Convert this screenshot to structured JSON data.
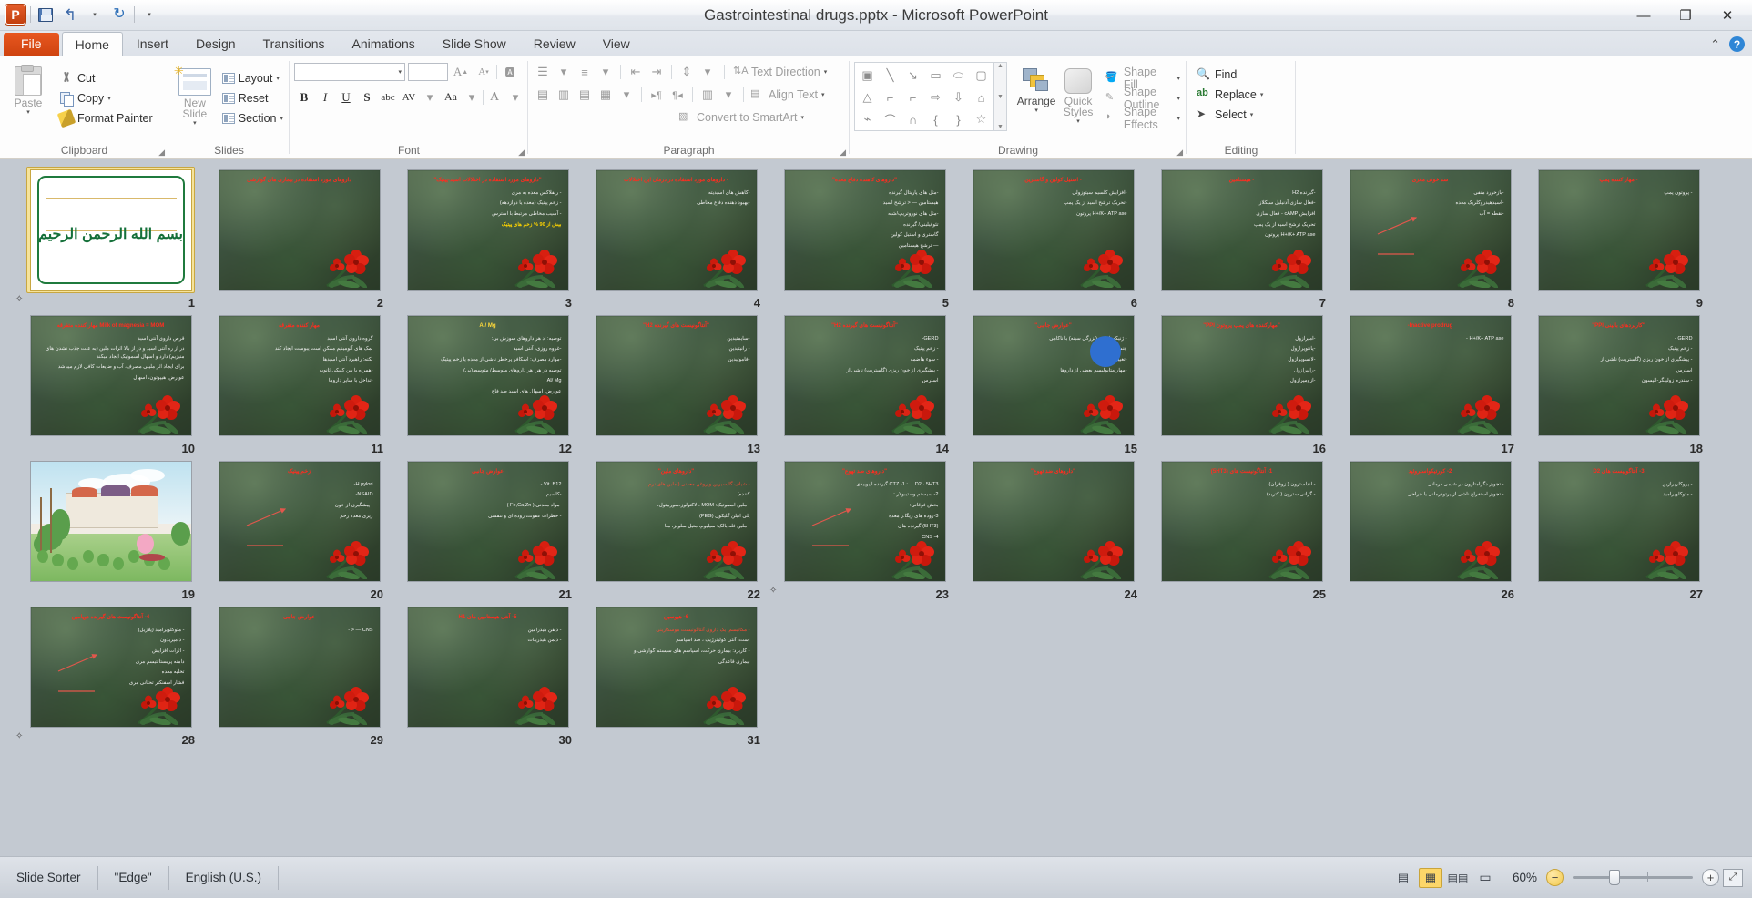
{
  "titlebar": {
    "doc_title": "Gastrointestinal drugs.pptx  -  Microsoft PowerPoint",
    "app_icon": "powerpoint-icon",
    "qat": [
      {
        "name": "save-icon",
        "label": "Save"
      },
      {
        "name": "undo-icon",
        "label": "↰"
      },
      {
        "name": "undo-dropdown-icon",
        "label": "▾"
      },
      {
        "name": "redo-icon",
        "label": "↻"
      },
      {
        "name": "customize-qat-icon",
        "label": "▾"
      }
    ],
    "window_controls": {
      "minimize": "—",
      "restore": "❐",
      "close": "✕"
    }
  },
  "ribbon": {
    "file_tab": "File",
    "tabs": [
      "Home",
      "Insert",
      "Design",
      "Transitions",
      "Animations",
      "Slide Show",
      "Review",
      "View"
    ],
    "active_tab": "Home",
    "minimize_ribbon_icon": "⌃",
    "help_icon": "?",
    "groups": {
      "clipboard": {
        "label": "Clipboard",
        "paste": "Paste",
        "cut": "Cut",
        "copy": "Copy",
        "format_painter": "Format Painter"
      },
      "slides": {
        "label": "Slides",
        "new_slide": "New Slide",
        "layout": "Layout",
        "reset": "Reset",
        "section": "Section"
      },
      "font": {
        "label": "Font",
        "font_name": "",
        "font_size": "",
        "grow_font": "A",
        "shrink_font": "A",
        "clear_formatting": "Aa",
        "bold": "B",
        "italic": "I",
        "underline": "U",
        "shadow": "S",
        "strikethrough": "abc",
        "character_spacing": "AV",
        "change_case": "Aa",
        "font_color": "A"
      },
      "paragraph": {
        "label": "Paragraph",
        "bullets": "Bullets",
        "numbering": "Numbering",
        "decrease_indent": "Decrease List Level",
        "increase_indent": "Increase List Level",
        "line_spacing": "Line Spacing",
        "align_left": "Align Left",
        "center": "Center",
        "align_right": "Align Right",
        "justify": "Justify",
        "ltr": "Left-to-Right",
        "rtl": "Right-to-Left",
        "columns": "Columns",
        "text_direction": "Text Direction",
        "align_text": "Align Text",
        "convert_to_smartart": "Convert to SmartArt"
      },
      "drawing": {
        "label": "Drawing",
        "arrange": "Arrange",
        "quick_styles": "Quick Styles",
        "shape_fill": "Shape Fill",
        "shape_outline": "Shape Outline",
        "shape_effects": "Shape Effects",
        "shapes": [
          "textbox",
          "line",
          "arrow",
          "rectangle",
          "oval",
          "rounded-rectangle",
          "triangle",
          "elbow-connector",
          "elbow-arrow-connector",
          "block-arrow-right",
          "block-arrow-down",
          "flowchart-shape",
          "freeform",
          "curve",
          "arc",
          "left-brace",
          "right-brace",
          "star"
        ]
      },
      "editing": {
        "label": "Editing",
        "find": "Find",
        "replace": "Replace",
        "select": "Select"
      }
    }
  },
  "statusbar": {
    "view_name": "Slide Sorter",
    "theme": "\"Edge\"",
    "language": "English (U.S.)",
    "view_buttons": [
      {
        "name": "normal-view-button",
        "label": "▤",
        "active": false
      },
      {
        "name": "slide-sorter-view-button",
        "label": "▦",
        "active": true
      },
      {
        "name": "reading-view-button",
        "label": "📖",
        "active": false
      },
      {
        "name": "slide-show-button",
        "label": "▭",
        "active": false
      }
    ],
    "zoom_level": "60%",
    "zoom_out_icon": "−",
    "zoom_in_icon": "+",
    "fit_to_window_icon": "fit-slide-icon"
  },
  "sorter": {
    "columns": 9,
    "selected_slide": 1,
    "slides": [
      {
        "n": 1,
        "type": "title-white",
        "bism": "بسم الله الرحمن الرحيم",
        "transition": true
      },
      {
        "n": 2,
        "type": "content",
        "title": "داروهای مورد استفاده در بیماری های گوارشی",
        "title_center": true,
        "lines": []
      },
      {
        "n": 3,
        "type": "content",
        "title": "\"داروهای مورد استفاده در اختلالات اسید-پپتیک\"",
        "lines": [
          "- ریفلاکس معده به مری",
          "- زخم پپتیک (معده یا دوازدهه)",
          "- آسیب مخاطی مرتبط با استرس",
          "بیش از 90 % زخم های پپتیک"
        ],
        "yellow_last": true
      },
      {
        "n": 4,
        "type": "content",
        "title": "- داروهای مورد استفاده در درمان این اختلالات",
        "lines": [
          "-کاهش های اسیدیته",
          "-بهبود دهنده دفاع مخاطی"
        ]
      },
      {
        "n": 5,
        "type": "content",
        "title": "\"داروهای کاهنده دفاع معده\"",
        "lines": [
          "-مثل های پاریتال گیرنده",
          "هیستامین — < ترشح اسید",
          "-مثل های نوروتریپ/شبه",
          "تئوفیلینی/ گیرنده",
          "گاستری و استیل کولین",
          "— ترشح هیستامین"
        ]
      },
      {
        "n": 6,
        "type": "content",
        "title": "- استیل کولین و گاسترین",
        "lines": [
          "-افزایش کلسیم سیتوزولی",
          "-تحریک ترشح اسید از یک پمپ",
          "H+/K+ ATP ase پروتون"
        ]
      },
      {
        "n": 7,
        "type": "content",
        "title": "- هیستامین",
        "lines": [
          "-گیرنده H2",
          "-فعال سازی آدنیلیل سیکلاز",
          "افزایش cAMP - فعال سازی",
          "تحریک ترشح اسید از یک پمپ",
          "H+/K+ ATP ase پروتون"
        ]
      },
      {
        "n": 8,
        "type": "content",
        "title": "سد خونی مغزی",
        "lines": [
          "-بازخورد منفی",
          "-اسیدهیدروکلریک معده",
          "-نقطه = آب"
        ],
        "arrows": true
      },
      {
        "n": 9,
        "type": "content",
        "title": "- مهار کننده پمپ",
        "lines": [
          "- پروتون پمپ"
        ]
      },
      {
        "n": 10,
        "type": "content",
        "title": "Milk of magnesia = MOM مهار کننده متفرقه",
        "lines": [
          "قرص داروی آنتی اسید",
          "در از ره آنتی اسید و در از بالا اثرات ملین (به علت جذب نشدن های منیزیم) دارد و اسهال اسموتیک ایجاد میکند",
          "برای ایجاد اثر ملینی مصرف، آب و ضایعات کافی لازم میباشد",
          "عوارض: هیپوتون، اسهال"
        ]
      },
      {
        "n": 11,
        "type": "content",
        "title": "مهار کننده متفرقه",
        "lines": [
          "گروه داروی آنتی اسید",
          "نمک های آلومینیم ممکن است یبوست ایجاد کند",
          "نکته: راهبرد آنتی اسیدها",
          "-همراه با بین کلیکی ثانویه",
          "-تداخل با سایر داروها"
        ],
        "yellow_mid": true
      },
      {
        "n": 12,
        "type": "content",
        "title": "Al/ Mg",
        "lines": [
          "توصیه: اد هر داروهای سوزش بی:",
          "-غروه روزی، آنتی اسید",
          "-موارد مصرف: اسکافر پرخطر ناشی از معده یا زخم پپتیک",
          "توصیه در هر، هر داروهای متوسط/ متوسط(بی):",
          "Al/ Mg",
          "عوارض: اسهال های اسید ضد فاج"
        ],
        "yellow_title": true
      },
      {
        "n": 13,
        "type": "content",
        "title": "\"آنتاگونیست های گیرنده H2\"",
        "lines": [
          "-سایمتیدین",
          "- رانیتیدین",
          "-فاموتیدین"
        ]
      },
      {
        "n": 14,
        "type": "content",
        "title": "\"آنتاگونیست های گیرنده H2\"",
        "lines": [
          "GERD-",
          "- زخم پپتیک",
          "- سوء هاضمه",
          "- پیشگیری از خون ریزی (گاستریت) ناشی از",
          "استرس"
        ]
      },
      {
        "n": 15,
        "type": "content",
        "title": "\"عوارض جانبی\"",
        "lines": [
          "- ژنیکوماستی (بزرگی سینه) با ناکامی",
          "جنسی در آقایان",
          "-تغییرات باقی",
          "-مهار متابولیسم بعضی از داروها"
        ],
        "circle": true
      },
      {
        "n": 16,
        "type": "content",
        "title": "\"مهارکننده های پمپ پروتون PPI\"",
        "lines": [
          "-امپرازول",
          "-پانتوپرازول",
          "-لانسوپرازول",
          "-رابپرازول",
          "-ازومپرازول"
        ]
      },
      {
        "n": 17,
        "type": "content",
        "title": "Inactive  prodrug-",
        "lines": [
          "H+/K+ ATP ase -"
        ]
      },
      {
        "n": 18,
        "type": "content",
        "title": "\"کاربردهای بالینی PPI\"",
        "lines": [
          "GERD -",
          "- زخم پپتیک",
          "- پیشگیری از خون ریزی (گاستریت) ناشی از",
          "استرس",
          "- سندرم زولینگر-الیسون"
        ]
      },
      {
        "n": 19,
        "type": "painting",
        "transition": false
      },
      {
        "n": 20,
        "type": "content",
        "title": "زخم پپتیک",
        "lines": [
          "H.pylori-",
          "NSAID-",
          "- پیشگیری از خون",
          "ریزی معده زخم"
        ],
        "arrows": true
      },
      {
        "n": 21,
        "type": "content",
        "title": "عوارض جانبی",
        "lines": [
          "Vit. B12 -",
          "-کلسیم",
          "-مواد معدنی ( Fe,Ca,Zn )",
          "- خطرات عفونت روده ای و تنفسی"
        ]
      },
      {
        "n": 22,
        "type": "content",
        "title": "\"داروهای ملین\"",
        "lines": [
          "- شیاف گلیسیرین و روغن معدنی ( ملین های نرم",
          "کننده)",
          "- ملین اسموتیک: MOM ، لاکتولوز،سوربیتول،",
          "پلی اتیلن گلیکول (PEG)",
          "- ملین فله بالک: سیلیوم، متیل سلولز، منا"
        ],
        "red_mid": true
      },
      {
        "n": 23,
        "type": "content",
        "title": "\"داروهای ضد تهوع\"",
        "lines": [
          "CTZ -1 : ... D2 ، 5HT3 گیرنده اپیوییدی",
          "2- سیستم وستیبولار : ...",
          "بخش فوقانی:",
          "3-روده های ریگا.ر معده",
          "(5HT3) گیرنده های",
          "CNS -4"
        ],
        "arrows": true,
        "transition": true
      },
      {
        "n": 24,
        "type": "content",
        "title": "\"داروهای ضد تهوع\"",
        "lines": []
      },
      {
        "n": 25,
        "type": "content",
        "title": "1- آنتاگونیست های (5HT3)",
        "lines": [
          "- انداسترون ( زوفران)",
          "- گرانی سترون ( کترید)"
        ]
      },
      {
        "n": 26,
        "type": "content",
        "title": "2- کورتیکواستروئید",
        "lines": [
          "- تجویز دگزامتازون در شیمی درمانی",
          "- تجویز استفراغ ناشی از پرتودرمانی یا جراحی"
        ]
      },
      {
        "n": 27,
        "type": "content",
        "title": "3- آنتاگونیست های D2",
        "lines": [
          "- پروکلرپرازین",
          "- متوکلوپرامید"
        ]
      },
      {
        "n": 28,
        "type": "content",
        "title": "4- آنتاگونیست های گیرنده دوپامین",
        "lines": [
          "- متوکلوپرامید (پلازیل)",
          "- دامپریدون",
          "- اثرات افزایش",
          "دامنه پریستالتیسم مری",
          "تخلیه معده",
          "فشار اسفنکتر تحتانی مری"
        ],
        "arrows": true,
        "transition": true
      },
      {
        "n": 29,
        "type": "content",
        "title": "عوارض جانبی",
        "lines": [
          "CNS — < -"
        ]
      },
      {
        "n": 30,
        "type": "content",
        "title": "5- آنتی هیستامین های H1",
        "lines": [
          "- دیفن هیدرامین",
          "- دیمن هیدرینات"
        ]
      },
      {
        "n": 31,
        "type": "content",
        "title": "6- هیوسین",
        "lines": [
          "- مکانیسم: یک داروی آنتاگونیست موسکارینی",
          "است، آنتی کولینرژیک ، ضد اسپاسم",
          "- کاربرد: بیماری حرکت، اسپاسم های سیستم گوارشی و",
          "بیماری قاعدگی"
        ],
        "red_mid": true
      }
    ]
  }
}
